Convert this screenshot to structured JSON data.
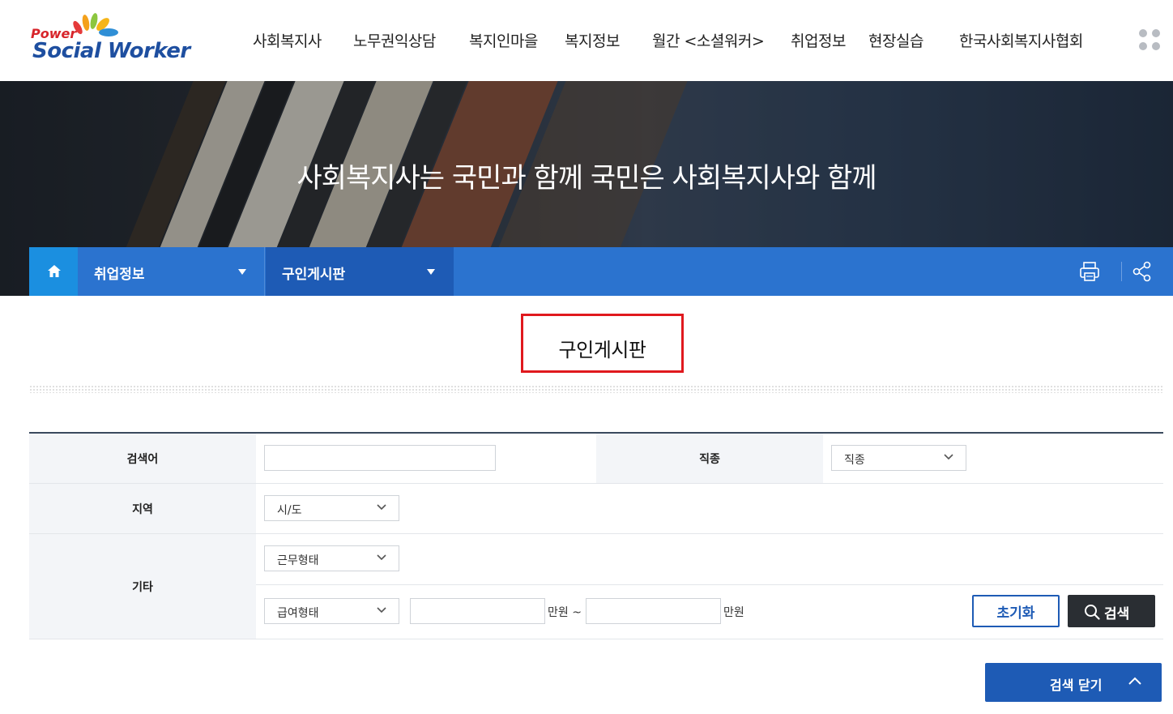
{
  "logo": {
    "top": "Power",
    "main": "Social Worker"
  },
  "gnb": [
    {
      "label": "사회복지사"
    },
    {
      "label": "노무권익상담"
    },
    {
      "label": "복지인마을"
    },
    {
      "label": "복지정보"
    },
    {
      "label": "월간 <소셜워커>"
    },
    {
      "label": "취업정보"
    },
    {
      "label": "현장실습"
    },
    {
      "label": "한국사회복지사협회"
    }
  ],
  "visual": {
    "title": "사회복지사는 국민과 함께 국민은 사회복지사와 함께"
  },
  "location": {
    "depth1": "취업정보",
    "depth2": "구인게시판"
  },
  "page": {
    "title": "구인게시판"
  },
  "search": {
    "keyword_label": "검색어",
    "keyword_value": "",
    "job_label": "직종",
    "job_select": "직종",
    "region_label": "지역",
    "region_select": "시/도",
    "etc_label": "기타",
    "work_type_select": "근무형태",
    "salary_type_select": "급여형태",
    "salary_min_value": "",
    "salary_unit_from": "만원 ~",
    "salary_max_value": "",
    "salary_unit_to": "만원",
    "reset_label": "초기화",
    "search_label": "검색",
    "close_label": "검색 닫기"
  },
  "colors": {
    "brand_blue": "#2b73cf",
    "home_blue": "#1b8fe0",
    "dark_blue": "#1e5bb5",
    "highlight_red": "#e0191e"
  }
}
